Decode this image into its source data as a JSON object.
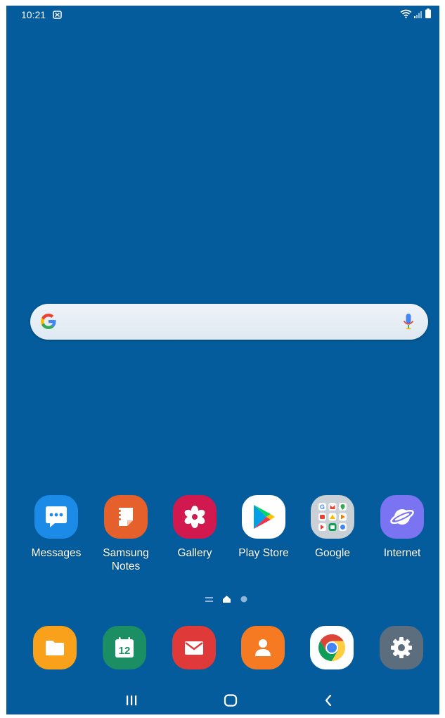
{
  "status_bar": {
    "time": "10:21"
  },
  "search_bar": {
    "icons": [
      "google-g-icon",
      "microphone-icon"
    ]
  },
  "home_apps": [
    {
      "label": "Messages",
      "color": "#1c8be8",
      "icon": "chat-bubble-icon"
    },
    {
      "label": "Samsung\nNotes",
      "color": "#e5602a",
      "icon": "notes-icon"
    },
    {
      "label": "Gallery",
      "color": "#d2194f",
      "icon": "flower-icon"
    },
    {
      "label": "Play Store",
      "color": "#ffffff",
      "icon": "play-triangle-icon"
    },
    {
      "label": "Google",
      "color": "#c9d0d6",
      "icon": "folder-grid-icon"
    },
    {
      "label": "Internet",
      "color": "#7b74f2",
      "icon": "planet-icon"
    }
  ],
  "dock_apps": [
    {
      "name": "My Files",
      "color": "#f9a11b",
      "icon": "folder-icon"
    },
    {
      "name": "Calendar",
      "color": "#1c8e63",
      "icon": "calendar-icon",
      "day": "12"
    },
    {
      "name": "Email",
      "color": "#e0393a",
      "icon": "envelope-icon"
    },
    {
      "name": "Contacts",
      "color": "#f57a22",
      "icon": "person-icon"
    },
    {
      "name": "Chrome",
      "color": "#ffffff",
      "icon": "chrome-icon"
    },
    {
      "name": "Settings",
      "color": "#5c6d7e",
      "icon": "gear-icon"
    }
  ],
  "page_indicator": {
    "pages": 2,
    "current": 1
  },
  "nav_bar": {
    "buttons": [
      "recents-button",
      "home-button",
      "back-button"
    ]
  }
}
